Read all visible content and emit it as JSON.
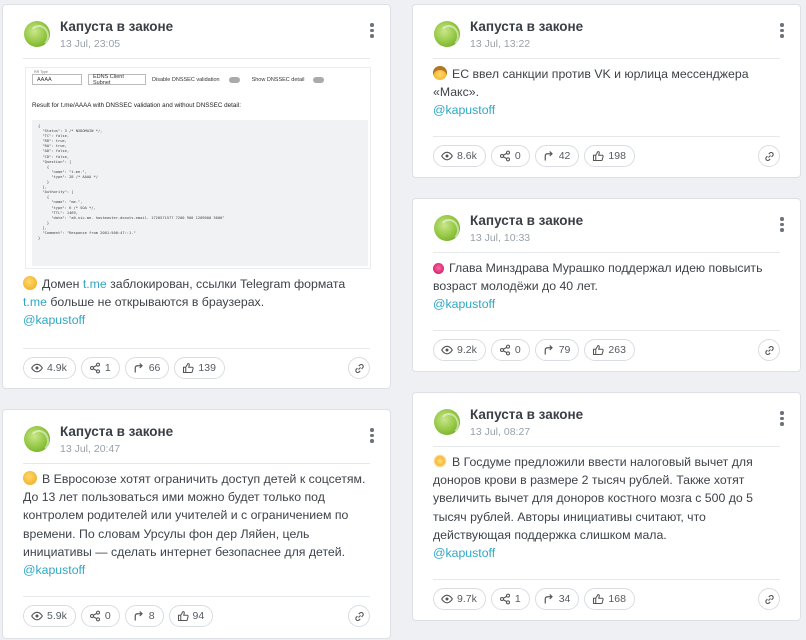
{
  "channel_name": "Капуста в законе",
  "handle": "@kapustoff",
  "posts": [
    {
      "date": "13 Jul, 23:05",
      "image": {
        "type_label": "RR Type",
        "type_value": "AAAA",
        "subnet_label": "EDNS Client Subnet",
        "dnssec_label": "Disable DNSSEC validation",
        "detail_label": "Show DNSSEC detail",
        "result": "Result for t.me/AAAA with DNSSEC validation and without DNSSEC detail:",
        "json": "{\n  \"Status\": 3 /* NXDOMAIN */,\n  \"TC\": false,\n  \"RD\": true,\n  \"RA\": true,\n  \"AD\": false,\n  \"CD\": false,\n  \"Question\": [\n    {\n      \"name\": \"t.me.\",\n      \"type\": 28 /* AAAA */\n    }\n  ],\n  \"Authority\": [\n    {\n      \"name\": \"me.\",\n      \"type\": 6 /* SOA */,\n      \"TTL\": 1469,\n      \"data\": \"a0.nic.me. hostmaster.donuts.email. 1720571577 7200 900 1209600 3600\"\n    }\n  ],\n  \"Comment\": \"Response from 2001:500:47::1.\"\n}"
      },
      "text_before": "Домен ",
      "link1": "t.me",
      "text_middle": " заблокирован, ссылки Telegram формата ",
      "link2": "t.me",
      "text_after": " больше не открываются в браузерах.",
      "views": "4.9k",
      "shares": "1",
      "forwards": "66",
      "likes": "139"
    },
    {
      "date": "13 Jul, 13:22",
      "text": "ЕС ввел санкции против VK и юрлица мессенджера «Макс».",
      "views": "8.6k",
      "shares": "0",
      "forwards": "42",
      "likes": "198"
    },
    {
      "date": "13 Jul, 10:33",
      "text": "Глава Минздрава Мурашко поддержал идею повысить возраст молодёжи до 40 лет.",
      "views": "9.2k",
      "shares": "0",
      "forwards": "79",
      "likes": "263"
    },
    {
      "date": "13 Jul, 20:47",
      "text": "В Евросоюзе хотят ограничить доступ детей к соцсетям. До 13 лет пользоваться ими можно будет только под контролем родителей или учителей и с ограничением по времени. По словам Урсулы фон дер Ляйен, цель инициативы — сделать интернет безопаснее для детей.",
      "views": "5.9k",
      "shares": "0",
      "forwards": "8",
      "likes": "94"
    },
    {
      "date": "13 Jul, 08:27",
      "text": "В Госдуме предложили ввести налоговый вычет для доноров крови в размере 2 тысяч рублей. Также хотят увеличить вычет для доноров костного мозга с 500 до 5 тысяч рублей. Авторы инициативы считают, что действующая поддержка слишком мала.",
      "views": "9.7k",
      "shares": "1",
      "forwards": "34",
      "likes": "168"
    }
  ],
  "colors": {
    "link": "#2fa7c4",
    "border": "#dde1e6",
    "background": "#eef0f3"
  },
  "icons": [
    "channel-avatar-icon",
    "more-vertical-icon",
    "eye-icon",
    "share-icon",
    "forward-icon",
    "thumbs-up-icon",
    "link-icon"
  ]
}
